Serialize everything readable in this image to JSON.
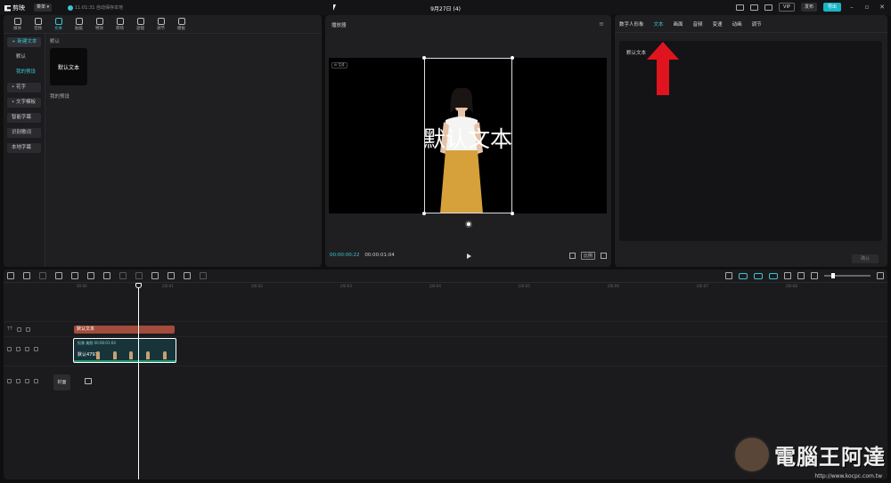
{
  "titlebar": {
    "app_name": "剪映",
    "menu_label": "菜单",
    "autosave": "11:01:31 自动保存本地",
    "project_title": "9月27日 (4)",
    "vip_label": "VIP",
    "publish_label": "发布",
    "export_label": "导出"
  },
  "media_tools": [
    "媒体",
    "音频",
    "文本",
    "贴纸",
    "特效",
    "转场",
    "滤镜",
    "调节",
    "模板"
  ],
  "sidebar": {
    "items": [
      {
        "label": "+ 新建文本"
      },
      {
        "label": "默认"
      },
      {
        "label": "我的预设"
      },
      {
        "label": "• 花字"
      },
      {
        "label": "• 文字模板"
      },
      {
        "label": "智能字幕"
      },
      {
        "label": "识别歌词"
      },
      {
        "label": "本地字幕"
      }
    ]
  },
  "content": {
    "section_label": "默认",
    "preset_card": "默认文本",
    "my_preset_label": "我的预设"
  },
  "player": {
    "title": "播放器",
    "tag": "AI 生成",
    "overlay_text": "默认文本",
    "current_time": "00:00:00:22",
    "total_time": "00:00:01:04",
    "ratio_label": "比例"
  },
  "inspector": {
    "tabs": [
      "数字人形象",
      "文本",
      "画面",
      "音频",
      "变速",
      "动画",
      "调节"
    ],
    "text_value": "默认文本",
    "confirm_label": "确认"
  },
  "timeline": {
    "ruler": [
      "00:00",
      "|00:01",
      "|00:02",
      "|00:03",
      "|00:04",
      "|00:05",
      "|00:06",
      "|00:07",
      "|00:08"
    ],
    "text_clip_label": "默认文本",
    "video_clip_label": "抠像 美颜  00:00:01:04",
    "video_clip_name": "默认4791",
    "cover_label": "封面"
  },
  "watermark": {
    "text": "電腦王阿達",
    "url": "http://www.kocpc.com.tw"
  },
  "colors": {
    "accent": "#39c6d2",
    "text_clip": "#a24c3b",
    "arrow": "#e0141e",
    "panel": "#1f1f22"
  }
}
